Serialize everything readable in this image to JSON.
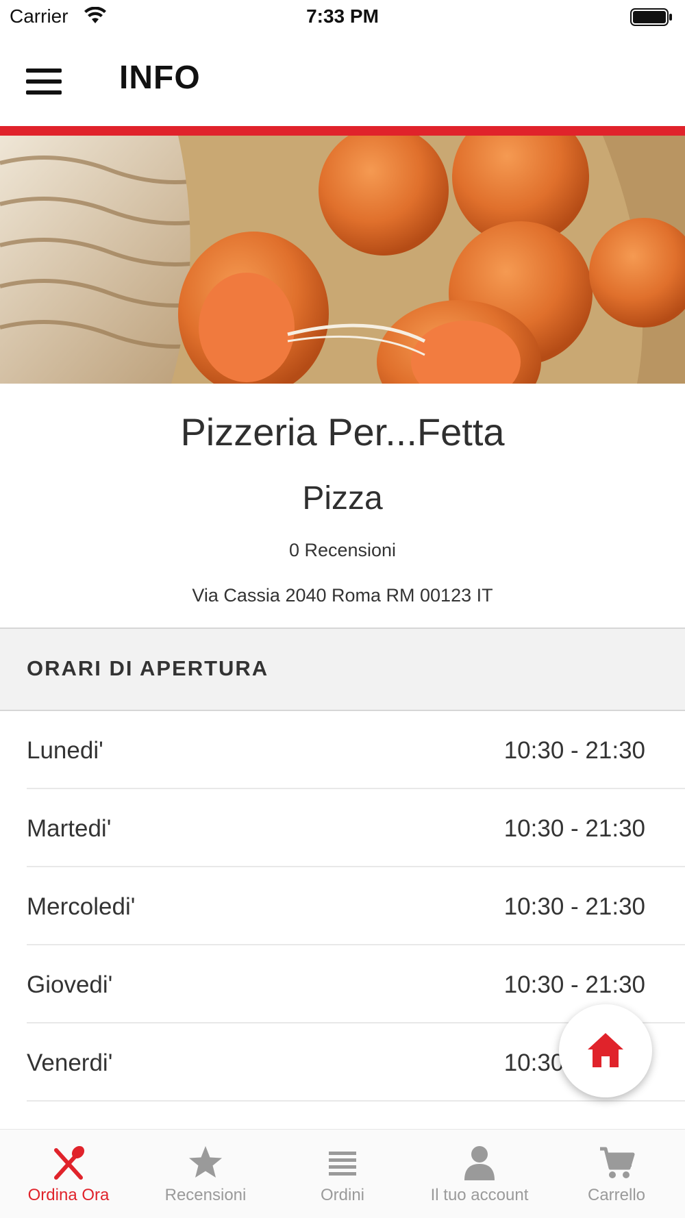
{
  "status_bar": {
    "carrier": "Carrier",
    "time": "7:33 PM"
  },
  "header": {
    "title": "INFO"
  },
  "restaurant": {
    "name": "Pizzeria Per...Fetta",
    "category": "Pizza",
    "reviews": "0 Recensioni",
    "address": "Via Cassia 2040 Roma RM 00123 IT"
  },
  "hours": {
    "title": "ORARI DI APERTURA",
    "days": [
      {
        "day": "Lunedi'",
        "time": "10:30 - 21:30"
      },
      {
        "day": "Martedi'",
        "time": "10:30 - 21:30"
      },
      {
        "day": "Mercoledi'",
        "time": "10:30 - 21:30"
      },
      {
        "day": "Giovedi'",
        "time": "10:30 - 21:30"
      },
      {
        "day": "Venerdi'",
        "time": "10:30 - 21:30"
      }
    ]
  },
  "tabs": [
    {
      "label": "Ordina Ora",
      "icon": "utensils-icon",
      "active": true
    },
    {
      "label": "Recensioni",
      "icon": "star-icon",
      "active": false
    },
    {
      "label": "Ordini",
      "icon": "list-icon",
      "active": false
    },
    {
      "label": "Il tuo account",
      "icon": "user-icon",
      "active": false
    },
    {
      "label": "Carrello",
      "icon": "cart-icon",
      "active": false
    }
  ],
  "colors": {
    "accent": "#e0232b",
    "inactive": "#9a9a9a"
  }
}
